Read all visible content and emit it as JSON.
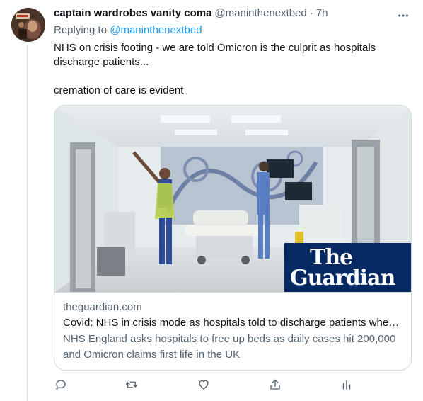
{
  "tweet": {
    "display_name": "captain wardrobes vanity coma",
    "handle": "@maninthenextbed",
    "separator": "·",
    "time": "7h",
    "replying_prefix": "Replying to",
    "replying_to": "@maninthenextbed",
    "text_line1": "NHS on crisis footing - we are told Omicron is the culprit as hospitals discharge patients...",
    "text_line2": "cremation of care is evident"
  },
  "card": {
    "publisher_logo_line1": "The",
    "publisher_logo_line2": "Guardian",
    "domain": "theguardian.com",
    "title": "Covid: NHS in crisis mode as hospitals told to discharge patients where possible",
    "description": "NHS England asks hospitals to free up beds as daily cases hit 200,000 and Omicron claims first life in the UK"
  },
  "icons": {
    "more": "more-horizontal-icon",
    "reply": "reply-icon",
    "retweet": "retweet-icon",
    "like": "heart-icon",
    "share": "share-icon",
    "analytics": "analytics-icon"
  },
  "colors": {
    "accent": "#1d9bf0",
    "secondary_text": "#536471",
    "guardian_blue": "#052962"
  }
}
